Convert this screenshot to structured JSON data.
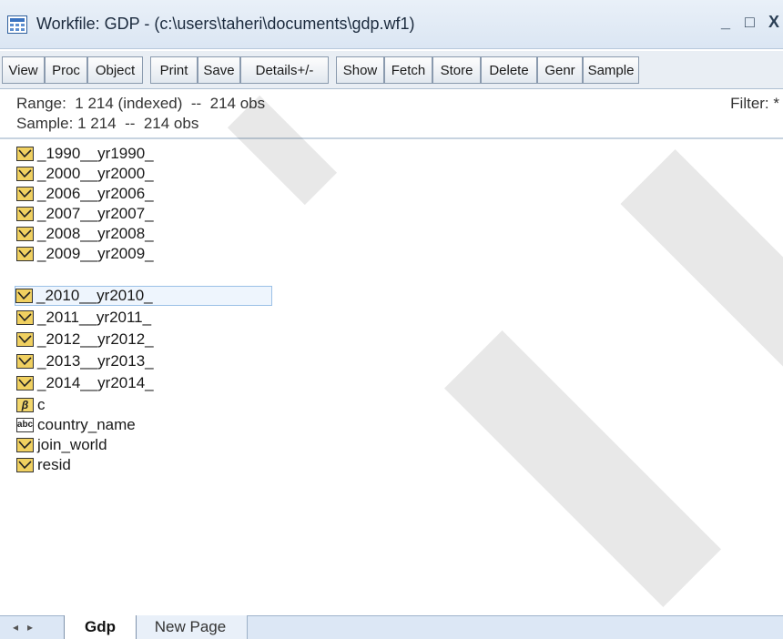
{
  "window": {
    "title": "Workfile: GDP - (c:\\users\\taheri\\documents\\gdp.wf1)",
    "minimize_glyph": "_",
    "maximize_glyph": "□",
    "close_glyph": "X"
  },
  "toolbar": {
    "buttons": [
      "View",
      "Proc",
      "Object",
      "Print",
      "Save",
      "Details+/-",
      "Show",
      "Fetch",
      "Store",
      "Delete",
      "Genr",
      "Sample"
    ]
  },
  "info": {
    "range": "Range:  1 214 (indexed)  --  214 obs",
    "sample": "Sample: 1 214  --  214 obs",
    "filter": "Filter: *"
  },
  "objects": [
    {
      "name": "_1990__yr1990_",
      "type": "series",
      "icon": "series-icon"
    },
    {
      "name": "_2000__yr2000_",
      "type": "series",
      "icon": "series-icon"
    },
    {
      "name": "_2006__yr2006_",
      "type": "series",
      "icon": "series-icon"
    },
    {
      "name": "_2007__yr2007_",
      "type": "series",
      "icon": "series-icon"
    },
    {
      "name": "_2008__yr2008_",
      "type": "series",
      "icon": "series-icon"
    },
    {
      "name": "_2009__yr2009_",
      "type": "series",
      "icon": "series-icon"
    },
    {
      "name": "_2010__yr2010_",
      "type": "series",
      "icon": "series-icon",
      "selected": true
    },
    {
      "name": "_2011__yr2011_",
      "type": "series",
      "icon": "series-icon"
    },
    {
      "name": "_2012__yr2012_",
      "type": "series",
      "icon": "series-icon"
    },
    {
      "name": "_2013__yr2013_",
      "type": "series",
      "icon": "series-icon"
    },
    {
      "name": "_2014__yr2014_",
      "type": "series",
      "icon": "series-icon"
    },
    {
      "name": "c",
      "type": "coefficient",
      "icon": "beta-icon",
      "glyph": "β"
    },
    {
      "name": "country_name",
      "type": "alpha",
      "icon": "abc-icon",
      "glyph": "abc"
    },
    {
      "name": "join_world",
      "type": "series",
      "icon": "series-icon"
    },
    {
      "name": "resid",
      "type": "series",
      "icon": "series-icon"
    }
  ],
  "tabs": {
    "nav_left": "◂",
    "nav_right": "▸",
    "items": [
      {
        "label": "Gdp",
        "active": true
      },
      {
        "label": "New Page",
        "active": false
      }
    ]
  },
  "colors": {
    "series_icon_fill": "#f0d060",
    "selection_border": "#9bc0e6",
    "tabbar_bg": "#dce7f5"
  }
}
